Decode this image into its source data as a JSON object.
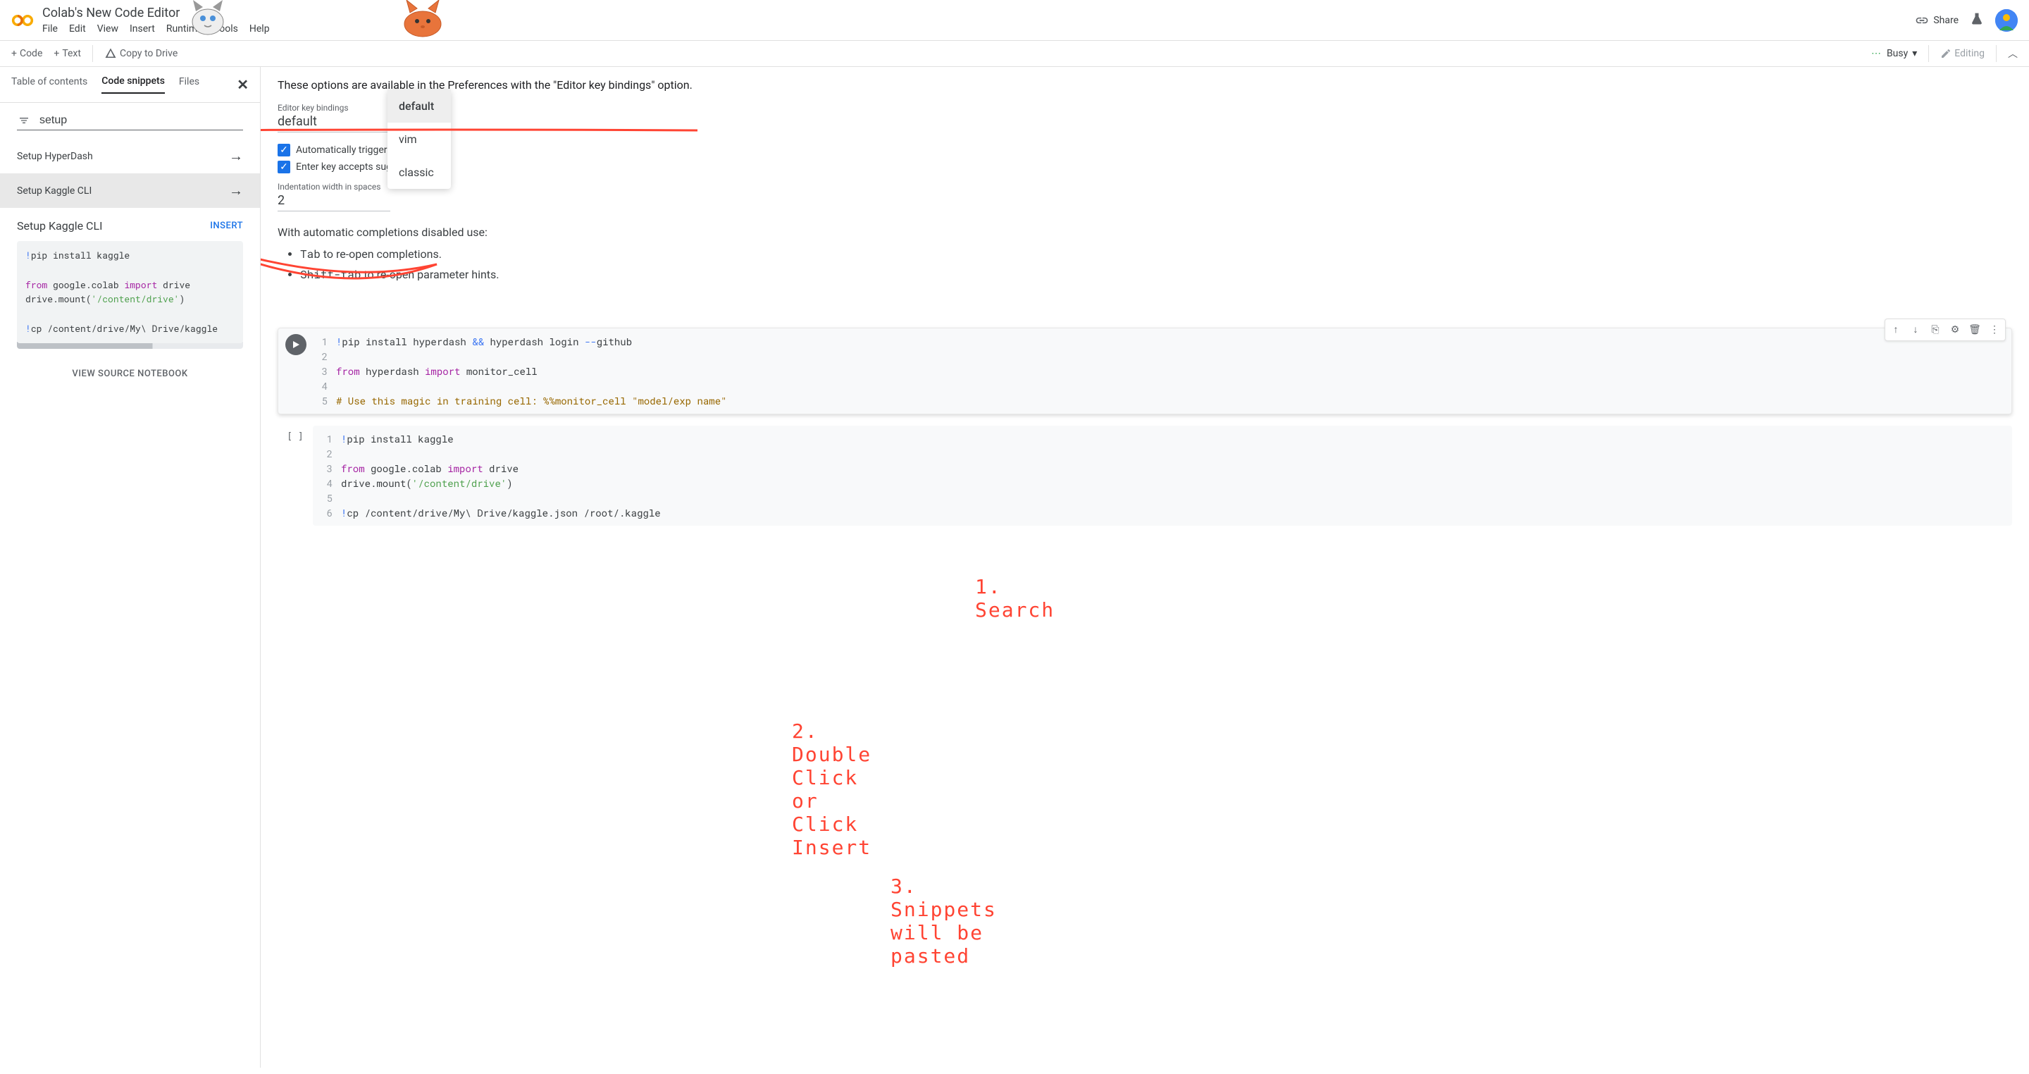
{
  "header": {
    "doc_title": "Colab's New Code Editor",
    "menu": [
      "File",
      "Edit",
      "View",
      "Insert",
      "Runtime",
      "Tools",
      "Help"
    ],
    "share_label": "Share"
  },
  "toolbar": {
    "code_btn": "Code",
    "text_btn": "Text",
    "copy_drive": "Copy to Drive",
    "busy_label": "Busy",
    "editing_label": "Editing"
  },
  "sidebar": {
    "tabs": [
      "Table of contents",
      "Code snippets",
      "Files"
    ],
    "search_value": "setup",
    "snippets": [
      {
        "title": "Setup HyperDash"
      },
      {
        "title": "Setup Kaggle CLI"
      }
    ],
    "detail_title": "Setup Kaggle CLI",
    "insert_label": "INSERT",
    "code_preview": "!pip install kaggle\n\nfrom google.colab import drive\ndrive.mount('/content/drive')\n\n!cp /content/drive/My\\ Drive/kaggle",
    "view_source": "VIEW SOURCE NOTEBOOK"
  },
  "content": {
    "pref_text": "These options are available in the Preferences with the \"Editor key bindings\" option.",
    "bindings_label": "Editor key bindings",
    "bindings_value": "default",
    "dropdown_options": [
      "default",
      "vim",
      "classic"
    ],
    "cb1_label": "Automatically trigger code completions",
    "cb2_label": "Enter key accepts suggestions",
    "indent_label": "Indentation width in spaces",
    "indent_value": "2",
    "auto_text": "With automatic completions disabled use:",
    "bullet1_key": "Tab",
    "bullet1_text": " to re-open completions.",
    "bullet2_key": "Shift-tab",
    "bullet2_text": " to re-open parameter hints."
  },
  "cells": [
    {
      "lines": [
        "!pip install hyperdash && hyperdash login --github",
        "",
        "from hyperdash import monitor_cell",
        "",
        "# Use this magic in training cell: %%monitor_cell \"model/exp name\""
      ]
    },
    {
      "exec": "[ ]",
      "lines": [
        "!pip install kaggle",
        "",
        "from google.colab import drive",
        "drive.mount('/content/drive')",
        "",
        "!cp /content/drive/My\\ Drive/kaggle.json /root/.kaggle"
      ]
    }
  ],
  "annotations": {
    "a1": "1. Search",
    "a2": "2. Double Click or Click Insert",
    "a3": "3. Snippets will be pasted"
  }
}
